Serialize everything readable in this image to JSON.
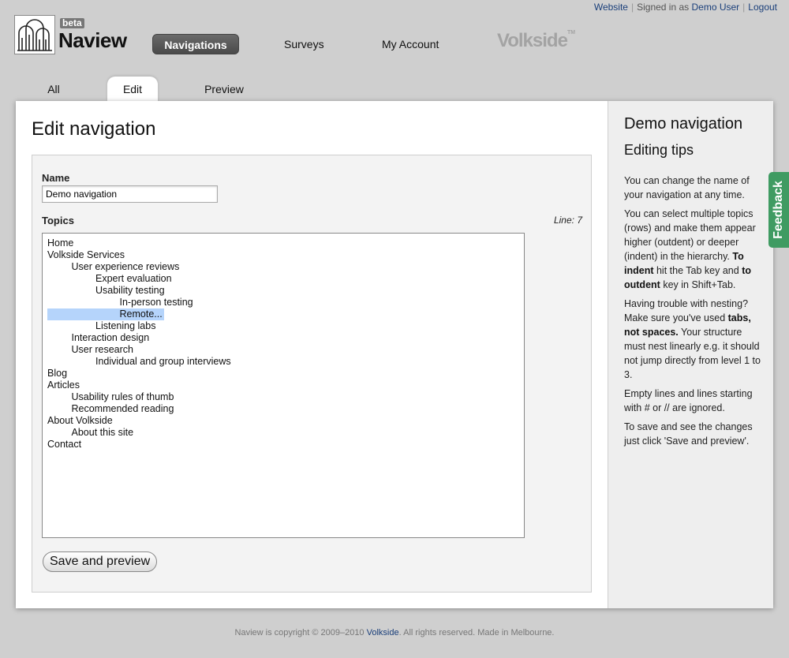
{
  "toplinks": {
    "website": "Website",
    "signed_in_prefix": "Signed in as",
    "user": "Demo User",
    "logout": "Logout"
  },
  "brand": {
    "beta": "beta",
    "name": "Naview"
  },
  "mainnav": {
    "navigations": "Navigations",
    "surveys": "Surveys",
    "account": "My Account",
    "partner_logo": "Volkside",
    "partner_tm": "TM"
  },
  "tabs": {
    "all": "All",
    "edit": "Edit",
    "preview": "Preview"
  },
  "main": {
    "title": "Edit navigation",
    "name_label": "Name",
    "name_value": "Demo navigation",
    "topics_label": "Topics",
    "line_indicator": "Line: 7",
    "topics": [
      "Home",
      "Volkside Services",
      "\tUser experience reviews",
      "\t\tExpert evaluation",
      "\t\tUsability testing",
      "\t\t\tIn-person testing",
      "\t\t\tRemote...",
      "\t\tListening labs",
      "\tInteraction design",
      "\tUser research",
      "\t\tIndividual and group interviews",
      "Blog",
      "Articles",
      "\tUsability rules of thumb",
      "\tRecommended reading",
      "About Volkside",
      "\tAbout this site",
      "Contact"
    ],
    "selected_line": 7,
    "save_label": "Save and preview"
  },
  "sidebar": {
    "title": "Demo navigation",
    "subtitle": "Editing tips",
    "tip1": "You can change the name of your navigation at any time.",
    "tip2_a": "You can select multiple topics (rows) and make them appear higher (outdent) or deeper (indent) in the hierarchy.",
    "tip2_b": "To indent",
    "tip2_c": "hit the Tab key and",
    "tip2_d": "to outdent",
    "tip2_e": "key in Shift+Tab.",
    "tip3_a": "Having trouble with nesting? Make sure you've used",
    "tip3_b": "tabs, not spaces.",
    "tip3_c": "Your structure must nest linearly e.g. it should not jump directly from level 1 to 3.",
    "tip4": "Empty lines and lines starting with # or // are ignored.",
    "tip5": "To save and see the changes just click 'Save and preview'."
  },
  "feedback": "Feedback",
  "footer": {
    "prefix": "Naview is copyright © 2009–2010",
    "link": "Volkside",
    "suffix": ". All rights reserved. Made in Melbourne."
  },
  "colors": {
    "background": "#cfcfcf",
    "active_nav": "#555555",
    "feedback": "#3f9b62",
    "selection": "#b5d4fb",
    "link": "#1a3f7a"
  }
}
